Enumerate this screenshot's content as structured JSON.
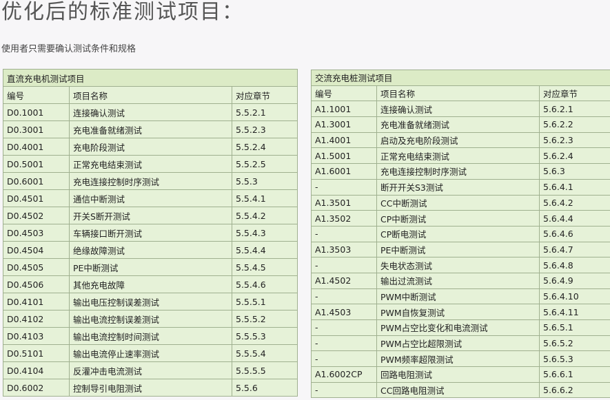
{
  "title": "优化后的标准测试项目：",
  "subtitle": "使用者只需要确认测试条件和规格",
  "dc_table": {
    "caption": "直流充电机测试项目",
    "headers": [
      "编号",
      "项目名称",
      "对应章节"
    ],
    "rows": [
      [
        "D0.1001",
        "连接确认测试",
        "5.5.2.1"
      ],
      [
        "D0.3001",
        "充电准备就绪测试",
        "5.5.2.3"
      ],
      [
        "D0.4001",
        "充电阶段测试",
        "5.5.2.4"
      ],
      [
        "D0.5001",
        "正常充电结束测试",
        "5.5.2.5"
      ],
      [
        "D0.6001",
        "充电连接控制时序测试",
        "5.5.3"
      ],
      [
        "D0.4501",
        "通信中断测试",
        "5.5.4.1"
      ],
      [
        "D0.4502",
        "开关S断开测试",
        "5.5.4.2"
      ],
      [
        "D0.4503",
        "车辆接口断开测试",
        "5.5.4.3"
      ],
      [
        "D0.4504",
        "绝缘故障测试",
        "5.5.4.4"
      ],
      [
        "D0.4505",
        "PE中断测试",
        "5.5.4.5"
      ],
      [
        "D0.4506",
        "其他充电故障",
        "5.5.4.6"
      ],
      [
        "D0.4101",
        "输出电压控制误差测试",
        "5.5.5.1"
      ],
      [
        "D0.4102",
        "输出电流控制误差测试",
        "5.5.5.2"
      ],
      [
        "D0.4103",
        "输出电流控制时间测试",
        "5.5.5.3"
      ],
      [
        "D0.5101",
        "输出电流停止速率测试",
        "5.5.5.4"
      ],
      [
        "D0.4104",
        "反灌冲击电流测试",
        "5.5.5.5"
      ],
      [
        "D0.6002",
        "控制导引电阻测试",
        "5.5.6"
      ]
    ]
  },
  "ac_table": {
    "caption": "交流充电桩测试项目",
    "headers": [
      "编号",
      "项目名称",
      "对应章节"
    ],
    "rows": [
      [
        "A1.1001",
        "连接确认测试",
        "5.6.2.1"
      ],
      [
        "A1.3001",
        "充电准备就绪测试",
        "5.6.2.2"
      ],
      [
        "A1.4001",
        "启动及充电阶段测试",
        "5.6.2.3"
      ],
      [
        "A1.5001",
        "正常充电结束测试",
        "5.6.2.4"
      ],
      [
        "A1.6001",
        "充电连接控制时序测试",
        "5.6.3"
      ],
      [
        "-",
        "断开开关S3测试",
        "5.6.4.1"
      ],
      [
        "A1.3501",
        "CC中断测试",
        "5.6.4.2"
      ],
      [
        "A1.3502",
        "CP中断测试",
        "5.6.4.4"
      ],
      [
        "-",
        "CP断电测试",
        "5.6.4.6"
      ],
      [
        "A1.3503",
        "PE中断测试",
        "5.6.4.7"
      ],
      [
        "-",
        "失电状态测试",
        "5.6.4.8"
      ],
      [
        "A1.4502",
        "输出过流测试",
        "5.6.4.9"
      ],
      [
        "-",
        "PWM中断测试",
        "5.6.4.10"
      ],
      [
        "A1.4503",
        "PWM自恢复测试",
        "5.6.4.11"
      ],
      [
        "-",
        "PWM占空比变化和电流测试",
        "5.6.5.1"
      ],
      [
        "-",
        "PWM占空比超限测试",
        "5.6.5.2"
      ],
      [
        "-",
        "PWM频率超限测试",
        "5.6.5.3"
      ],
      [
        "A1.6002CP",
        "回路电阻测试",
        "5.6.6.1"
      ],
      [
        "-",
        "CC回路电阻测试",
        "5.6.6.2"
      ]
    ]
  }
}
